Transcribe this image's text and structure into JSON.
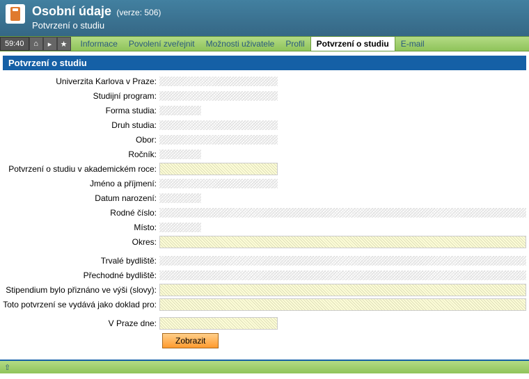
{
  "header": {
    "title": "Osobní údaje",
    "version": "(verze: 506)",
    "subtitle": "Potvrzení o studiu"
  },
  "toolbar": {
    "timer": "59:40"
  },
  "tabs": {
    "items": [
      {
        "label": "Informace"
      },
      {
        "label": "Povolení zveřejnit"
      },
      {
        "label": "Možnosti uživatele"
      },
      {
        "label": "Profil"
      },
      {
        "label": "Potvrzení o studiu"
      },
      {
        "label": "E-mail"
      }
    ]
  },
  "panel": {
    "title": "Potvrzení o studiu"
  },
  "form": {
    "rows": [
      {
        "label": "Univerzita Karlova v Praze:",
        "kind": "noisy short"
      },
      {
        "label": "Studijní program:",
        "kind": "noisy short"
      },
      {
        "label": "Forma studia:",
        "kind": "noisy tiny"
      },
      {
        "label": "Druh studia:",
        "kind": "noisy short"
      },
      {
        "label": "Obor:",
        "kind": "noisy short"
      },
      {
        "label": "Ročník:",
        "kind": "noisy tiny"
      },
      {
        "label": "Potvrzení o studiu v akademickém roce:",
        "kind": "input-like noisy",
        "extra": "short"
      },
      {
        "label": "Jméno a příjmení:",
        "kind": "noisy short"
      },
      {
        "label": "Datum narození:",
        "kind": "noisy tiny"
      },
      {
        "label": "Rodné číslo:",
        "kind": "noisy"
      },
      {
        "label": "Místo:",
        "kind": "noisy tiny"
      },
      {
        "label": "Okres:",
        "kind": "input-like noisy"
      },
      {
        "label": "",
        "kind": "spacer"
      },
      {
        "label": "Trvalé bydliště:",
        "kind": "noisy"
      },
      {
        "label": "Přechodné bydliště:",
        "kind": "noisy"
      },
      {
        "label": "Stipendium bylo přiznáno ve výši (slovy):",
        "kind": "input-like noisy"
      },
      {
        "label": "Toto potvrzení se vydává jako doklad pro:",
        "kind": "input-like noisy"
      },
      {
        "label": "",
        "kind": "spacer"
      },
      {
        "label": "V Praze dne:",
        "kind": "input-like noisy",
        "extra": "short"
      }
    ],
    "submit": "Zobrazit"
  }
}
